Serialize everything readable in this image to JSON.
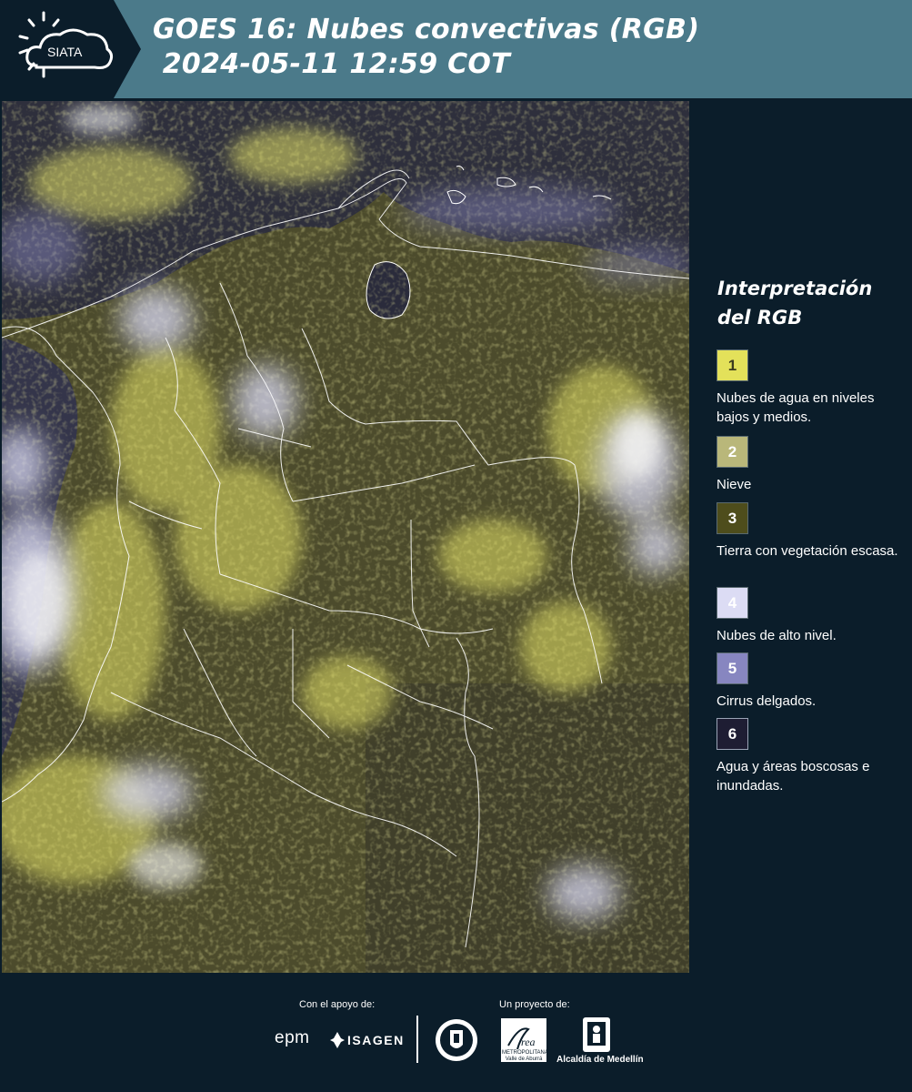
{
  "header": {
    "logo_text": "SIATA",
    "title_line1": "GOES 16: Nubes convectivas (RGB)",
    "title_line2": " 2024-05-11 12:59 COT"
  },
  "map": {
    "icon": "satellite-rgb-map-colombia"
  },
  "legend": {
    "title": "Interpretación del RGB",
    "items": [
      {
        "number": "1",
        "label": "Nubes de agua en niveles bajos y medios.",
        "color": "#e3e15a",
        "text_color": "#3b3b1e"
      },
      {
        "number": "2",
        "label": "Nieve",
        "color": "#b9b77a",
        "text_color": "#ffffff"
      },
      {
        "number": "3",
        "label": "Tierra con vegetación escasa.",
        "color": "#4e4d1c",
        "text_color": "#ffffff"
      },
      {
        "number": "4",
        "label": "Nubes de alto nivel.",
        "color": "#dcdcf4",
        "text_color": "#ffffff"
      },
      {
        "number": "5",
        "label": "Cirrus delgados.",
        "color": "#8786c0",
        "text_color": "#ffffff"
      },
      {
        "number": "6",
        "label": "Agua y áreas boscosas e inundadas.",
        "color": "#1e1d33",
        "text_color": "#ffffff"
      }
    ]
  },
  "footer": {
    "support_label": "Con el apoyo de:",
    "project_label": "Un proyecto de:",
    "sponsor_epm": "epm",
    "sponsor_isagen": "ISAGEN",
    "metro_logo_text": "METROPOLITANA Valle de Aburrá",
    "alcaldia_label": "Alcaldía de Medellín"
  }
}
